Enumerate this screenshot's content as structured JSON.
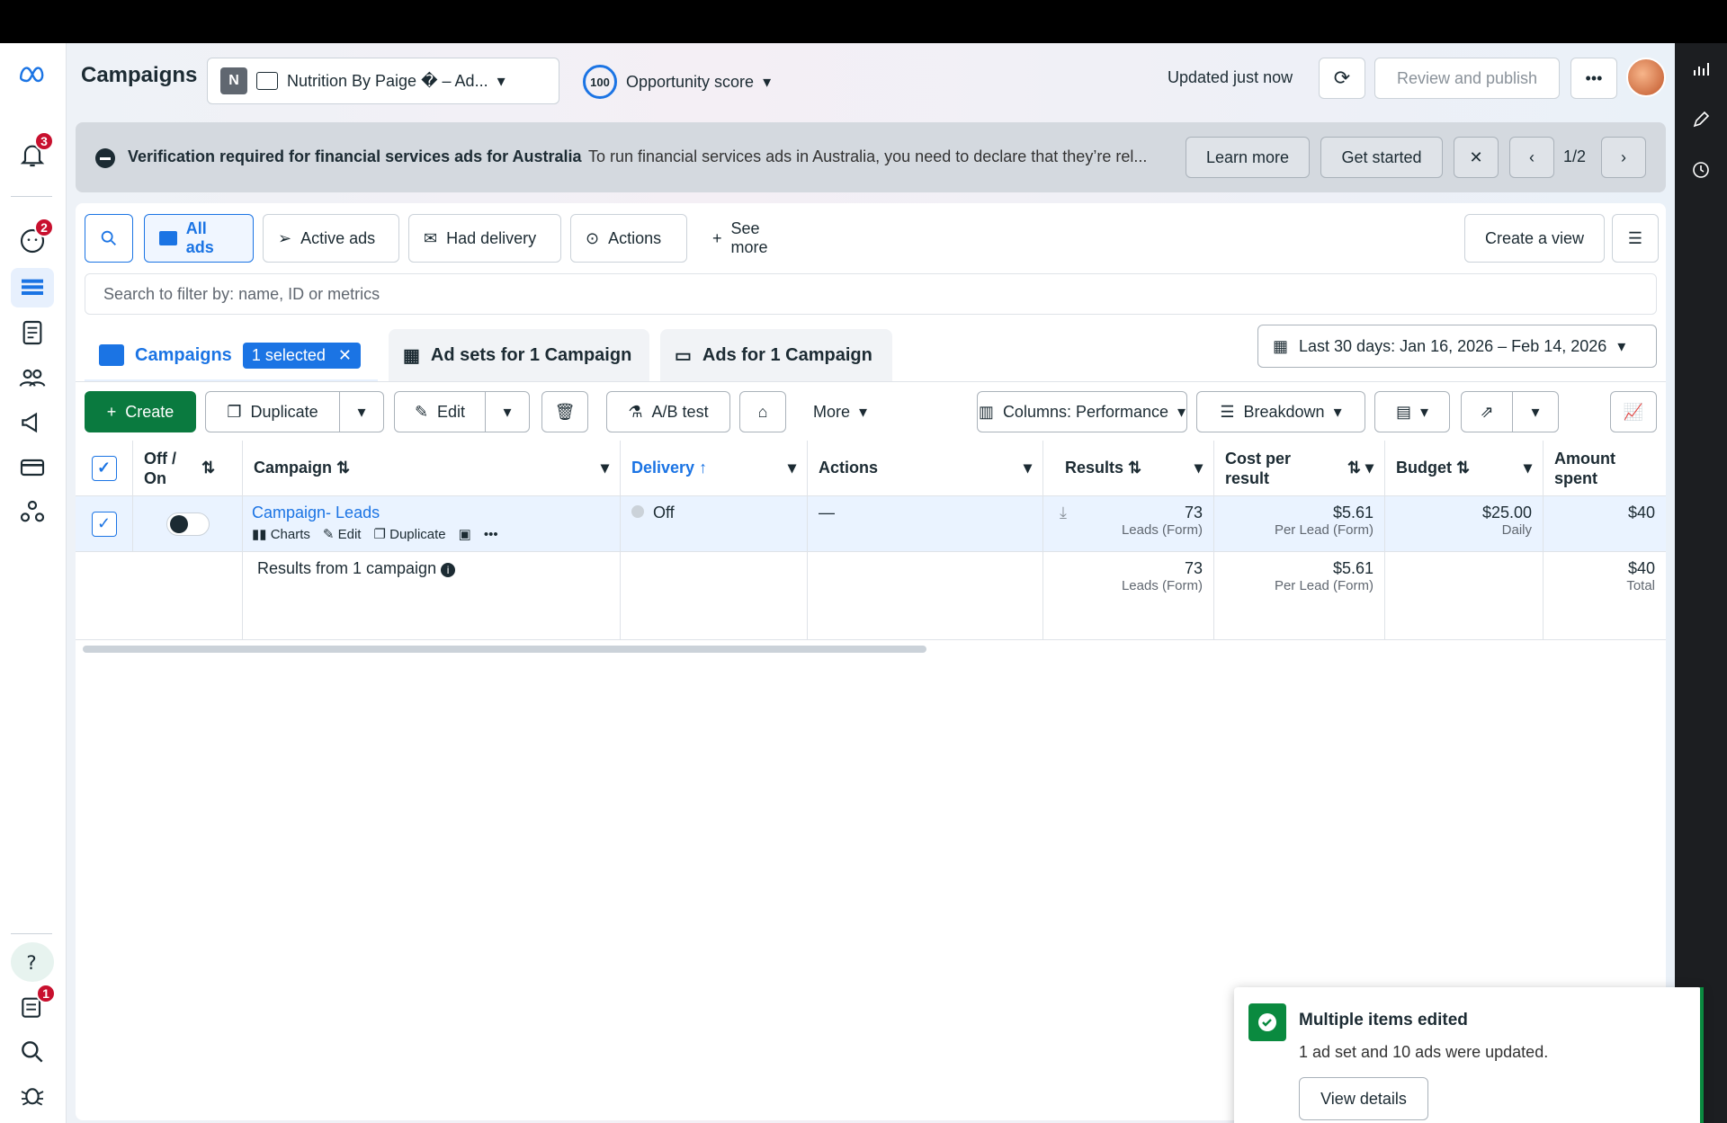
{
  "header": {
    "title": "Campaigns",
    "account_initial": "N",
    "account_name": "Nutrition By Paige � – Ad...",
    "opportunity_score": "100",
    "opportunity_label": "Opportunity score",
    "updated": "Updated just now",
    "review_publish": "Review and publish"
  },
  "nav_badges": {
    "notifications": "3",
    "messages": "2",
    "feedback": "1"
  },
  "banner": {
    "title": "Verification required for financial services ads for Australia",
    "text": "To run financial services ads in Australia, you need to declare that they’re rel...",
    "learn_more": "Learn more",
    "get_started": "Get started",
    "pager": "1/2"
  },
  "filters": {
    "all_ads": "All ads",
    "active_ads": "Active ads",
    "had_delivery": "Had delivery",
    "actions": "Actions",
    "see_more": "See more",
    "create_view": "Create a view",
    "search_placeholder": "Search to filter by: name, ID or metrics"
  },
  "tabs": {
    "campaigns": "Campaigns",
    "selected": "1 selected",
    "ad_sets": "Ad sets for 1 Campaign",
    "ads": "Ads for 1 Campaign"
  },
  "date_range": "Last 30 days: Jan 16, 2026 – Feb 14, 2026",
  "toolbar": {
    "create": "Create",
    "duplicate": "Duplicate",
    "edit": "Edit",
    "ab_test": "A/B test",
    "more": "More",
    "columns": "Columns: Performance",
    "breakdown": "Breakdown"
  },
  "table": {
    "headers": {
      "offon": "Off / On",
      "campaign": "Campaign",
      "delivery": "Delivery",
      "actions": "Actions",
      "results": "Results",
      "cost_per_result": "Cost per result",
      "budget": "Budget",
      "amount_spent": "Amount spent"
    },
    "row": {
      "campaign": "Campaign- Leads",
      "charts": "Charts",
      "edit": "Edit",
      "duplicate": "Duplicate",
      "delivery": "Off",
      "actions": "—",
      "results": "73",
      "results_sub": "Leads (Form)",
      "cpr": "$5.61",
      "cpr_sub": "Per Lead (Form)",
      "budget": "$25.00",
      "budget_sub": "Daily",
      "spent": "$40"
    },
    "summary": {
      "label": "Results from 1 campaign",
      "results": "73",
      "results_sub": "Leads (Form)",
      "cpr": "$5.61",
      "cpr_sub": "Per Lead (Form)",
      "spent": "$40",
      "spent_sub": "Total"
    }
  },
  "toast": {
    "title": "Multiple items edited",
    "text": "1 ad set and 10 ads were updated.",
    "button": "View details"
  },
  "colors": {
    "accent": "#1b74e4",
    "create_green": "#0a7a3f",
    "success": "#0a8a3f",
    "badge_red": "#c8102e"
  }
}
